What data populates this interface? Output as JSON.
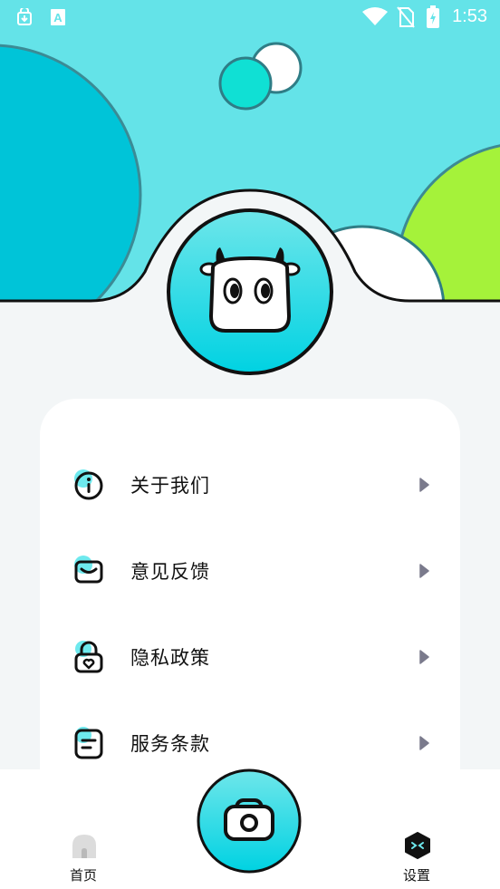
{
  "status_bar": {
    "time": "1:53",
    "icons": [
      "shield-download-icon",
      "text-a-icon",
      "wifi-icon",
      "no-sim-icon",
      "battery-charging-icon"
    ]
  },
  "profile": {
    "avatar_icon": "cow-mascot-icon"
  },
  "menu": {
    "items": [
      {
        "label": "关于我们",
        "icon": "info-icon"
      },
      {
        "label": "意见反馈",
        "icon": "feedback-mail-icon"
      },
      {
        "label": "隐私政策",
        "icon": "privacy-lock-icon"
      },
      {
        "label": "服务条款",
        "icon": "terms-document-icon"
      }
    ]
  },
  "tabbar": {
    "home_label": "首页",
    "settings_label": "设置",
    "active": "settings",
    "camera_icon": "camera-icon"
  },
  "colors": {
    "header_bg": "#64e3e8",
    "accent_cyan": "#00c4d8",
    "accent_green": "#a5f23a",
    "page_bg": "#f3f6f7"
  }
}
